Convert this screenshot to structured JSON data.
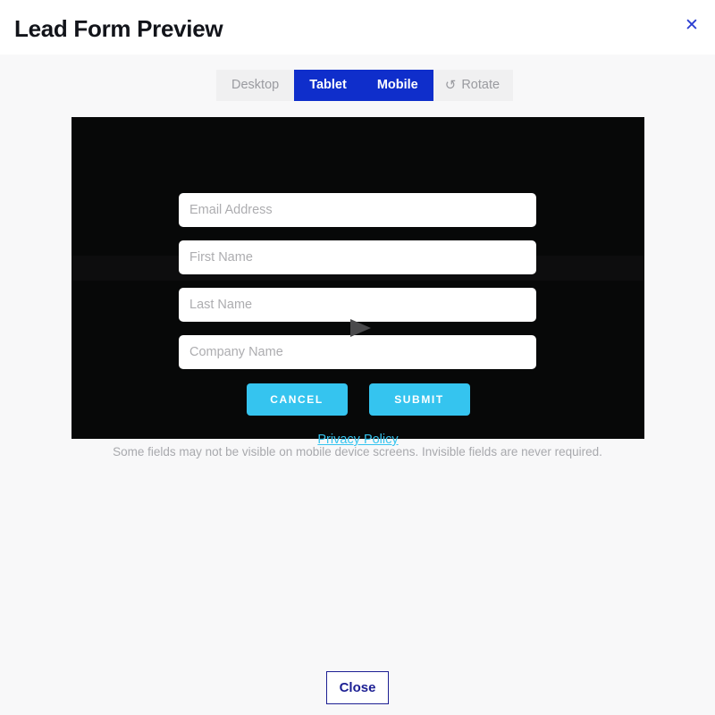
{
  "modal": {
    "title": "Lead Form Preview",
    "close_icon": "close-x-icon",
    "close_icon_glyph": "✕",
    "accent_blue": "#0f2ecb",
    "navy": "#1c1f93",
    "cyan": "#35c4ef",
    "canvas_bg": "#070808"
  },
  "device_toggle": {
    "options": [
      {
        "label": "Desktop",
        "active": false
      },
      {
        "label": "Tablet",
        "active": true
      },
      {
        "label": "Mobile",
        "active": true
      },
      {
        "label": "Rotate",
        "active": false,
        "icon": "rotate-ccw-icon",
        "icon_glyph": "↺"
      }
    ]
  },
  "preview_form": {
    "fields": [
      {
        "name": "email",
        "placeholder": "Email Address",
        "value": ""
      },
      {
        "name": "first-name",
        "placeholder": "First Name",
        "value": ""
      },
      {
        "name": "last-name",
        "placeholder": "Last Name",
        "value": ""
      },
      {
        "name": "company-name",
        "placeholder": "Company Name",
        "value": ""
      }
    ],
    "cancel_label": "Cancel",
    "submit_label": "Submit",
    "privacy_label": "Privacy Policy",
    "overlay_icon": "play-triangle-icon"
  },
  "helper_note": "Some fields may not be visible on mobile device screens. Invisible fields are never required.",
  "footer": {
    "close_label": "Close"
  }
}
